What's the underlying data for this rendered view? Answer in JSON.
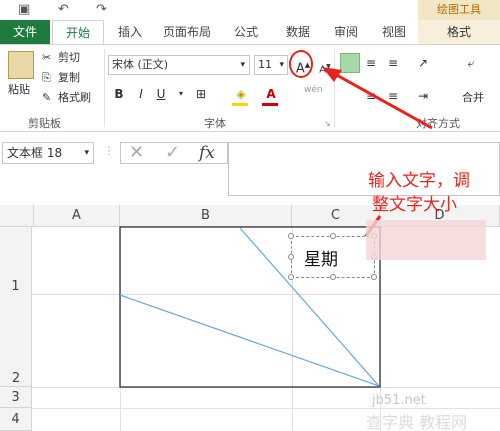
{
  "tabs": [
    "文件",
    "开始",
    "插入",
    "页面布局",
    "公式",
    "数据",
    "审阅",
    "视图"
  ],
  "contextual": {
    "group": "绘图工具",
    "tab": "格式"
  },
  "ribbon": {
    "clipboard": {
      "paste": "粘贴",
      "cut": "剪切",
      "copy": "复制",
      "format_painter": "格式刷",
      "label": "剪贴板"
    },
    "font": {
      "name": "宋体 (正文)",
      "size": "11",
      "grow": "A",
      "shrink": "A",
      "bold": "B",
      "italic": "I",
      "underline": "U",
      "label": "字体",
      "phonetic": "wén"
    },
    "alignment": {
      "label": "对齐方式",
      "merge": "合并"
    }
  },
  "formula_bar": {
    "name_box": "文本框 18",
    "fx": "fx",
    "value": ""
  },
  "columns": [
    "A",
    "B",
    "C",
    "D"
  ],
  "rows": [
    "1",
    "2",
    "3",
    "4"
  ],
  "textbox": {
    "text": "星期"
  },
  "annotation": {
    "line1": "输入文字，调",
    "line2": "整文字大小"
  },
  "watermark": {
    "line1": "jb51.net",
    "line2": "查字典 教程网"
  },
  "colors": {
    "file_tab": "#1f7a3e",
    "accent": "#217346",
    "annotation": "#e8231c"
  }
}
